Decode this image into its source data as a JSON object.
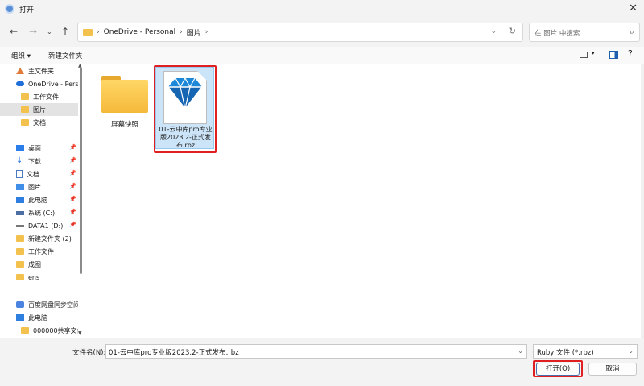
{
  "window": {
    "title": "打开"
  },
  "address": {
    "path": [
      "OneDrive - Personal",
      "图片"
    ]
  },
  "search": {
    "placeholder": "在 图片 中搜索"
  },
  "toolbar": {
    "organize_label": "组织 ▾",
    "new_folder_label": "新建文件夹"
  },
  "sidebar": {
    "items": [
      {
        "label": "主文件夹",
        "icon": "home-icon"
      },
      {
        "label": "OneDrive - Pers",
        "icon": "cloud-icon"
      },
      {
        "label": "工作文件",
        "icon": "folder-icon"
      },
      {
        "label": "图片",
        "icon": "folder-icon",
        "selected": true
      },
      {
        "label": "文档",
        "icon": "folder-icon"
      },
      {
        "label": "桌面",
        "icon": "desktop-icon",
        "pinned": true
      },
      {
        "label": "下载",
        "icon": "download-icon",
        "pinned": true
      },
      {
        "label": "文档",
        "icon": "document-icon",
        "pinned": true
      },
      {
        "label": "图片",
        "icon": "pictures-icon",
        "pinned": true
      },
      {
        "label": "此电脑",
        "icon": "computer-icon",
        "pinned": true
      },
      {
        "label": "系统 (C:)",
        "icon": "system-drive-icon",
        "pinned": true
      },
      {
        "label": "DATA1 (D:)",
        "icon": "drive-icon",
        "pinned": true
      },
      {
        "label": "新建文件夹 (2)",
        "icon": "folder-icon"
      },
      {
        "label": "工作文件",
        "icon": "folder-icon"
      },
      {
        "label": "成图",
        "icon": "folder-icon"
      },
      {
        "label": "ens",
        "icon": "folder-icon"
      },
      {
        "label": "百度网盘同步空间",
        "icon": "baidu-sync-icon"
      },
      {
        "label": "此电脑",
        "icon": "computer-icon"
      },
      {
        "label": "000000共享文件",
        "icon": "folder-icon"
      }
    ]
  },
  "files": [
    {
      "name": "屏幕快照",
      "type": "folder"
    },
    {
      "name": "01-云中库pro专业版2023.2-正式发布.rbz",
      "type": "rbz-file",
      "selected": true
    }
  ],
  "filename": {
    "label": "文件名(N):",
    "value": "01-云中库pro专业版2023.2-正式发布.rbz"
  },
  "filetype": {
    "value": "Ruby 文件 (*.rbz)"
  },
  "buttons": {
    "open": "打开(O)",
    "cancel": "取消"
  },
  "colors": {
    "highlight": "#e02020",
    "selection": "#cce4f7",
    "accent": "#1e6fd9"
  }
}
